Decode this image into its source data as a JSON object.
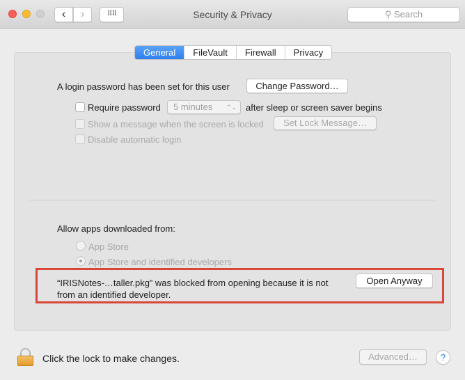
{
  "window": {
    "title": "Security & Privacy",
    "search_placeholder": "Search"
  },
  "tabs": [
    {
      "label": "General",
      "active": true
    },
    {
      "label": "FileVault"
    },
    {
      "label": "Firewall"
    },
    {
      "label": "Privacy"
    }
  ],
  "general": {
    "login_text": "A login password has been set for this user",
    "change_password": "Change Password…",
    "require_password": "Require password",
    "require_delay": "5 minutes",
    "after_sleep": "after sleep or screen saver begins",
    "show_message": "Show a message when the screen is locked",
    "set_lock_message": "Set Lock Message…",
    "disable_auto_login": "Disable automatic login"
  },
  "allow": {
    "label": "Allow apps downloaded from:",
    "options": [
      {
        "label": "App Store",
        "selected": false
      },
      {
        "label": "App Store and identified developers",
        "selected": true
      }
    ],
    "blocked_message_line1": "“IRISNotes-…taller.pkg” was blocked from opening because it is not",
    "blocked_message_line2": "from an identified developer.",
    "open_anyway": "Open Anyway",
    "highlight_color": "#d9463a"
  },
  "footer": {
    "lock_text": "Click the lock to make changes.",
    "advanced": "Advanced…",
    "help": "?"
  }
}
